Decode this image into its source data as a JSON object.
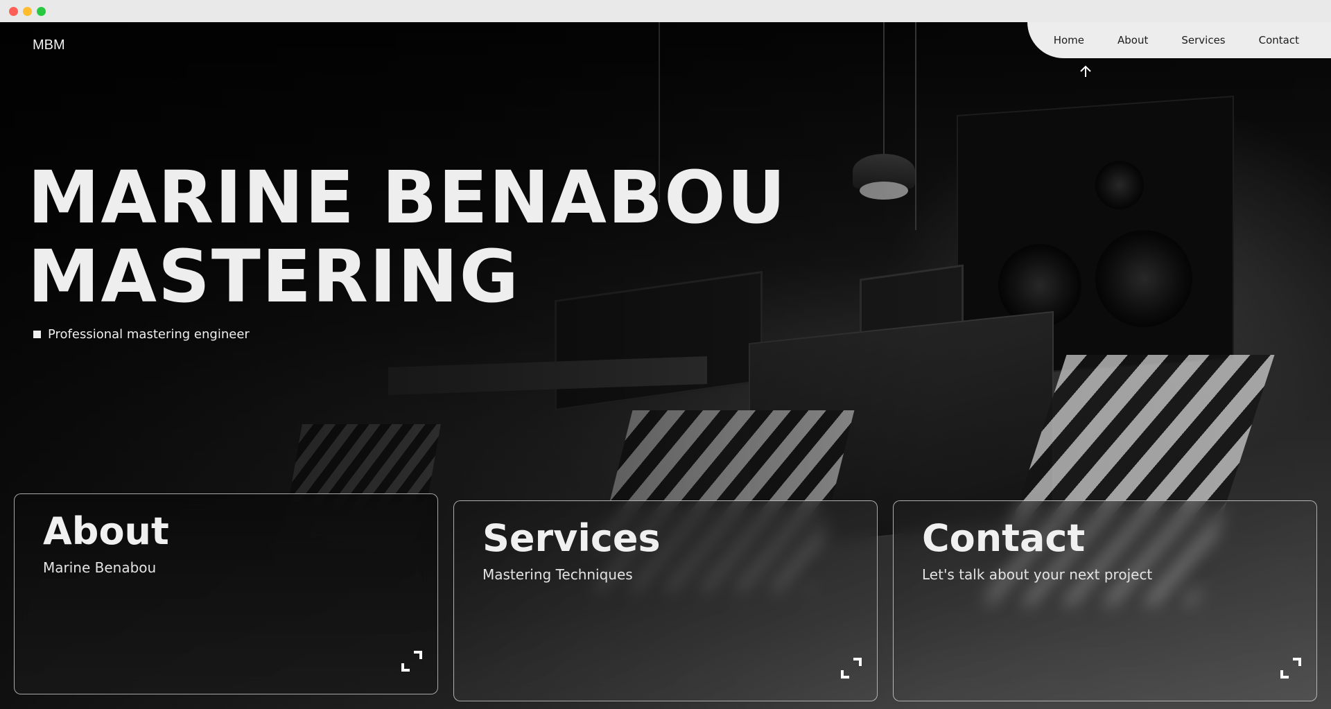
{
  "site": {
    "logo": "MBM",
    "nav": [
      {
        "label": "Home"
      },
      {
        "label": "About"
      },
      {
        "label": "Services"
      },
      {
        "label": "Contact"
      }
    ]
  },
  "hero": {
    "title_line1": "MARINE BENABOU",
    "title_line2": "MASTERING",
    "tagline": "Professional mastering engineer"
  },
  "cards": [
    {
      "title": "About",
      "subtitle": "Marine Benabou",
      "icon": "expand-icon"
    },
    {
      "title": "Services",
      "subtitle": "Mastering Techniques",
      "icon": "expand-icon"
    },
    {
      "title": "Contact",
      "subtitle": "Let's talk about your next project",
      "icon": "expand-icon"
    }
  ],
  "colors": {
    "nav_background": "#ededed",
    "text": "#f0f0f0",
    "background": "#0a0a0a"
  }
}
